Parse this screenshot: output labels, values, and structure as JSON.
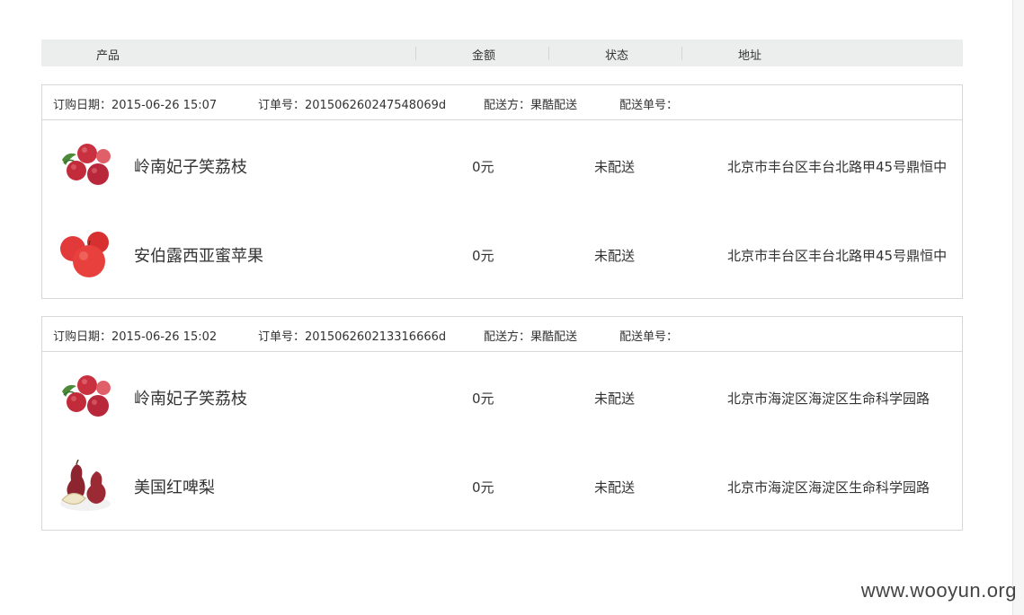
{
  "header": {
    "col_product": "产品",
    "col_amount": "金额",
    "col_status": "状态",
    "col_address": "地址"
  },
  "orders": [
    {
      "date_label": "订购日期：2015-06-26 15:07",
      "order_no_label": "订单号：201506260247548069d",
      "shipper_label": "配送方：果酷配送",
      "tracking_label": "配送单号：",
      "items": [
        {
          "icon": "lychee-icon",
          "name": "岭南妃子笑荔枝",
          "amount": "0元",
          "status": "未配送",
          "address": "北京市丰台区丰台北路甲45号鼎恒中"
        },
        {
          "icon": "apple-icon",
          "name": "安伯露西亚蜜苹果",
          "amount": "0元",
          "status": "未配送",
          "address": "北京市丰台区丰台北路甲45号鼎恒中"
        }
      ]
    },
    {
      "date_label": "订购日期：2015-06-26 15:02",
      "order_no_label": "订单号：201506260213316666d",
      "shipper_label": "配送方：果酷配送",
      "tracking_label": "配送单号：",
      "items": [
        {
          "icon": "lychee-icon",
          "name": "岭南妃子笑荔枝",
          "amount": "0元",
          "status": "未配送",
          "address": "北京市海淀区海淀区生命科学园路"
        },
        {
          "icon": "pear-icon",
          "name": "美国红啤梨",
          "amount": "0元",
          "status": "未配送",
          "address": "北京市海淀区海淀区生命科学园路"
        }
      ]
    }
  ],
  "watermark": "www.wooyun.org",
  "colors": {
    "header_bg": "#eceeee",
    "border": "#d7d7d7",
    "text": "#333333"
  }
}
